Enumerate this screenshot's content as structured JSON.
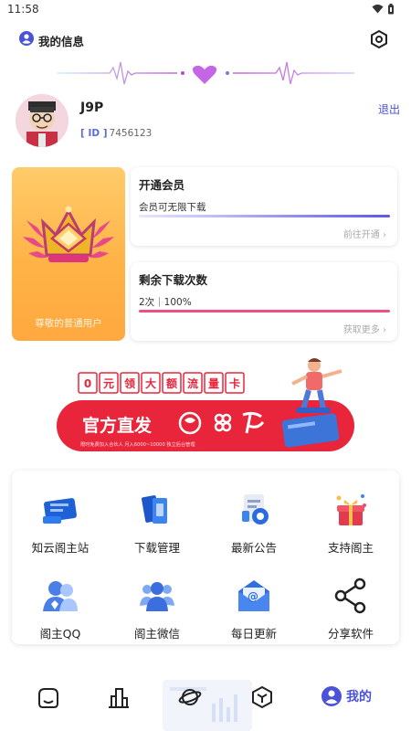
{
  "status_bar": {
    "time": "11:58"
  },
  "header": {
    "title": "我的信息",
    "user_icon": "user-icon",
    "settings_icon": "settings-hex-icon"
  },
  "profile": {
    "name": "J9P",
    "id_tag": "[ ID ]",
    "id_value": "7456123",
    "logout_label": "退出"
  },
  "member_card": {
    "label": "尊敬的普通用户"
  },
  "vip_card": {
    "title": "开通会员",
    "desc": "会员可无限下载",
    "link": "前往开通",
    "progress_percent": 100
  },
  "download_card": {
    "title": "剩余下载次数",
    "desc": "2次｜100%",
    "link": "获取更多",
    "remaining": 2,
    "progress_percent": 100
  },
  "banner": {
    "top_chars": [
      "0",
      "元",
      "领",
      "大",
      "额",
      "流",
      "量",
      "卡"
    ],
    "main_text": "官方直发",
    "sub_text": "限时免费加入合伙人 月入6000~10000 独立后台管理"
  },
  "grid": {
    "items": [
      {
        "label": "知云阁主站",
        "icon": "website-icon"
      },
      {
        "label": "下载管理",
        "icon": "download-cards-icon"
      },
      {
        "label": "最新公告",
        "icon": "announcement-icon"
      },
      {
        "label": "支持阁主",
        "icon": "gift-icon"
      },
      {
        "label": "阁主QQ",
        "icon": "qq-users-icon"
      },
      {
        "label": "阁主微信",
        "icon": "wechat-group-icon"
      },
      {
        "label": "每日更新",
        "icon": "mail-at-icon"
      },
      {
        "label": "分享软件",
        "icon": "share-icon"
      }
    ]
  },
  "bottom_nav": {
    "items": [
      {
        "name": "home",
        "icon": "home-smile-icon"
      },
      {
        "name": "rank",
        "icon": "buildings-icon"
      },
      {
        "name": "discover",
        "icon": "planet-icon"
      },
      {
        "name": "explore",
        "icon": "cube-icon"
      }
    ],
    "active_label": "我的"
  },
  "colors": {
    "accent": "#4a52d8",
    "member_orange": "#ffb347",
    "progress_pink": "#ee4f86",
    "banner_red": "#e8253a"
  }
}
